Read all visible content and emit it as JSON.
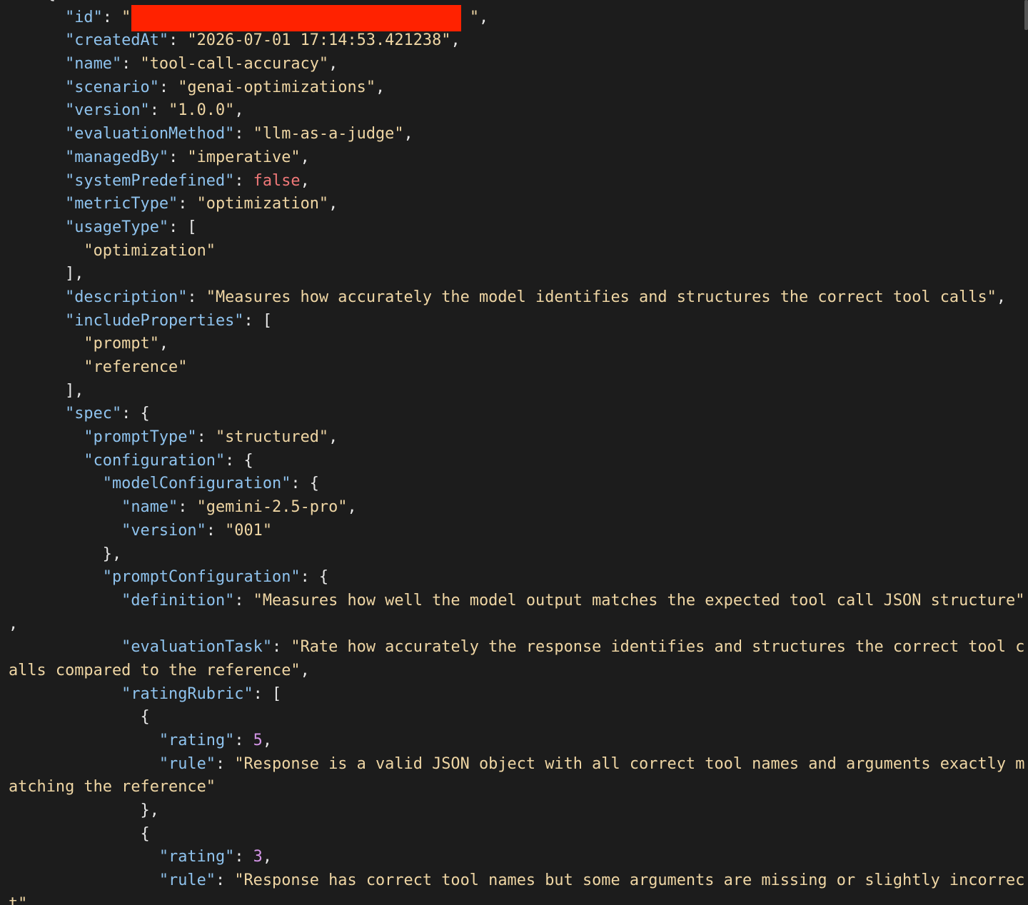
{
  "lines": [
    [
      {
        "t": "    {",
        "c": "p"
      }
    ],
    [
      {
        "t": "      \"id\"",
        "c": "k"
      },
      {
        "t": ": ",
        "c": "p"
      },
      {
        "t": "\"",
        "c": "s"
      },
      {
        "t": "                                    ",
        "c": "s"
      },
      {
        "t": "\"",
        "c": "s"
      },
      {
        "t": ",",
        "c": "p"
      }
    ],
    [
      {
        "t": "      \"createdAt\"",
        "c": "k"
      },
      {
        "t": ": ",
        "c": "p"
      },
      {
        "t": "\"2026-07-01 17:14:53.421238\"",
        "c": "s"
      },
      {
        "t": ",",
        "c": "p"
      }
    ],
    [
      {
        "t": "      \"name\"",
        "c": "k"
      },
      {
        "t": ": ",
        "c": "p"
      },
      {
        "t": "\"tool-call-accuracy\"",
        "c": "s"
      },
      {
        "t": ",",
        "c": "p"
      }
    ],
    [
      {
        "t": "      \"scenario\"",
        "c": "k"
      },
      {
        "t": ": ",
        "c": "p"
      },
      {
        "t": "\"genai-optimizations\"",
        "c": "s"
      },
      {
        "t": ",",
        "c": "p"
      }
    ],
    [
      {
        "t": "      \"version\"",
        "c": "k"
      },
      {
        "t": ": ",
        "c": "p"
      },
      {
        "t": "\"1.0.0\"",
        "c": "s"
      },
      {
        "t": ",",
        "c": "p"
      }
    ],
    [
      {
        "t": "      \"evaluationMethod\"",
        "c": "k"
      },
      {
        "t": ": ",
        "c": "p"
      },
      {
        "t": "\"llm-as-a-judge\"",
        "c": "s"
      },
      {
        "t": ",",
        "c": "p"
      }
    ],
    [
      {
        "t": "      \"managedBy\"",
        "c": "k"
      },
      {
        "t": ": ",
        "c": "p"
      },
      {
        "t": "\"imperative\"",
        "c": "s"
      },
      {
        "t": ",",
        "c": "p"
      }
    ],
    [
      {
        "t": "      \"systemPredefined\"",
        "c": "k"
      },
      {
        "t": ": ",
        "c": "p"
      },
      {
        "t": "false",
        "c": "b"
      },
      {
        "t": ",",
        "c": "p"
      }
    ],
    [
      {
        "t": "      \"metricType\"",
        "c": "k"
      },
      {
        "t": ": ",
        "c": "p"
      },
      {
        "t": "\"optimization\"",
        "c": "s"
      },
      {
        "t": ",",
        "c": "p"
      }
    ],
    [
      {
        "t": "      \"usageType\"",
        "c": "k"
      },
      {
        "t": ": [",
        "c": "p"
      }
    ],
    [
      {
        "t": "        \"optimization\"",
        "c": "s"
      }
    ],
    [
      {
        "t": "      ],",
        "c": "p"
      }
    ],
    [
      {
        "t": "      \"description\"",
        "c": "k"
      },
      {
        "t": ": ",
        "c": "p"
      },
      {
        "t": "\"Measures how accurately the model identifies and structures the correct tool calls\"",
        "c": "s"
      },
      {
        "t": ",",
        "c": "p"
      }
    ],
    [
      {
        "t": "      \"includeProperties\"",
        "c": "k"
      },
      {
        "t": ": [",
        "c": "p"
      }
    ],
    [
      {
        "t": "        \"prompt\"",
        "c": "s"
      },
      {
        "t": ",",
        "c": "p"
      }
    ],
    [
      {
        "t": "        \"reference\"",
        "c": "s"
      }
    ],
    [
      {
        "t": "      ],",
        "c": "p"
      }
    ],
    [
      {
        "t": "      \"spec\"",
        "c": "k"
      },
      {
        "t": ": {",
        "c": "p"
      }
    ],
    [
      {
        "t": "        \"promptType\"",
        "c": "k"
      },
      {
        "t": ": ",
        "c": "p"
      },
      {
        "t": "\"structured\"",
        "c": "s"
      },
      {
        "t": ",",
        "c": "p"
      }
    ],
    [
      {
        "t": "        \"configuration\"",
        "c": "k"
      },
      {
        "t": ": {",
        "c": "p"
      }
    ],
    [
      {
        "t": "          \"modelConfiguration\"",
        "c": "k"
      },
      {
        "t": ": {",
        "c": "p"
      }
    ],
    [
      {
        "t": "            \"name\"",
        "c": "k"
      },
      {
        "t": ": ",
        "c": "p"
      },
      {
        "t": "\"gemini-2.5-pro\"",
        "c": "s"
      },
      {
        "t": ",",
        "c": "p"
      }
    ],
    [
      {
        "t": "            \"version\"",
        "c": "k"
      },
      {
        "t": ": ",
        "c": "p"
      },
      {
        "t": "\"001\"",
        "c": "s"
      }
    ],
    [
      {
        "t": "          },",
        "c": "p"
      }
    ],
    [
      {
        "t": "          \"promptConfiguration\"",
        "c": "k"
      },
      {
        "t": ": {",
        "c": "p"
      }
    ],
    [
      {
        "t": "            \"definition\"",
        "c": "k"
      },
      {
        "t": ": ",
        "c": "p"
      },
      {
        "t": "\"Measures how well the model output matches the expected tool call JSON structure\"",
        "c": "s"
      }
    ],
    [
      {
        "t": ",",
        "c": "p"
      }
    ],
    [
      {
        "t": "            \"evaluationTask\"",
        "c": "k"
      },
      {
        "t": ": ",
        "c": "p"
      },
      {
        "t": "\"Rate how accurately the response identifies and structures the correct tool c",
        "c": "s"
      }
    ],
    [
      {
        "t": "alls compared to the reference\"",
        "c": "s"
      },
      {
        "t": ",",
        "c": "p"
      }
    ],
    [
      {
        "t": "            \"ratingRubric\"",
        "c": "k"
      },
      {
        "t": ": [",
        "c": "p"
      }
    ],
    [
      {
        "t": "              {",
        "c": "p"
      }
    ],
    [
      {
        "t": "                \"rating\"",
        "c": "k"
      },
      {
        "t": ": ",
        "c": "p"
      },
      {
        "t": "5",
        "c": "n"
      },
      {
        "t": ",",
        "c": "p"
      }
    ],
    [
      {
        "t": "                \"rule\"",
        "c": "k"
      },
      {
        "t": ": ",
        "c": "p"
      },
      {
        "t": "\"Response is a valid JSON object with all correct tool names and arguments exactly m",
        "c": "s"
      }
    ],
    [
      {
        "t": "atching the reference\"",
        "c": "s"
      }
    ],
    [
      {
        "t": "              },",
        "c": "p"
      }
    ],
    [
      {
        "t": "              {",
        "c": "p"
      }
    ],
    [
      {
        "t": "                \"rating\"",
        "c": "k"
      },
      {
        "t": ": ",
        "c": "p"
      },
      {
        "t": "3",
        "c": "n"
      },
      {
        "t": ",",
        "c": "p"
      }
    ],
    [
      {
        "t": "                \"rule\"",
        "c": "k"
      },
      {
        "t": ": ",
        "c": "p"
      },
      {
        "t": "\"Response has correct tool names but some arguments are missing or slightly incorrec",
        "c": "s"
      }
    ],
    [
      {
        "t": "t\"",
        "c": "s"
      }
    ]
  ]
}
